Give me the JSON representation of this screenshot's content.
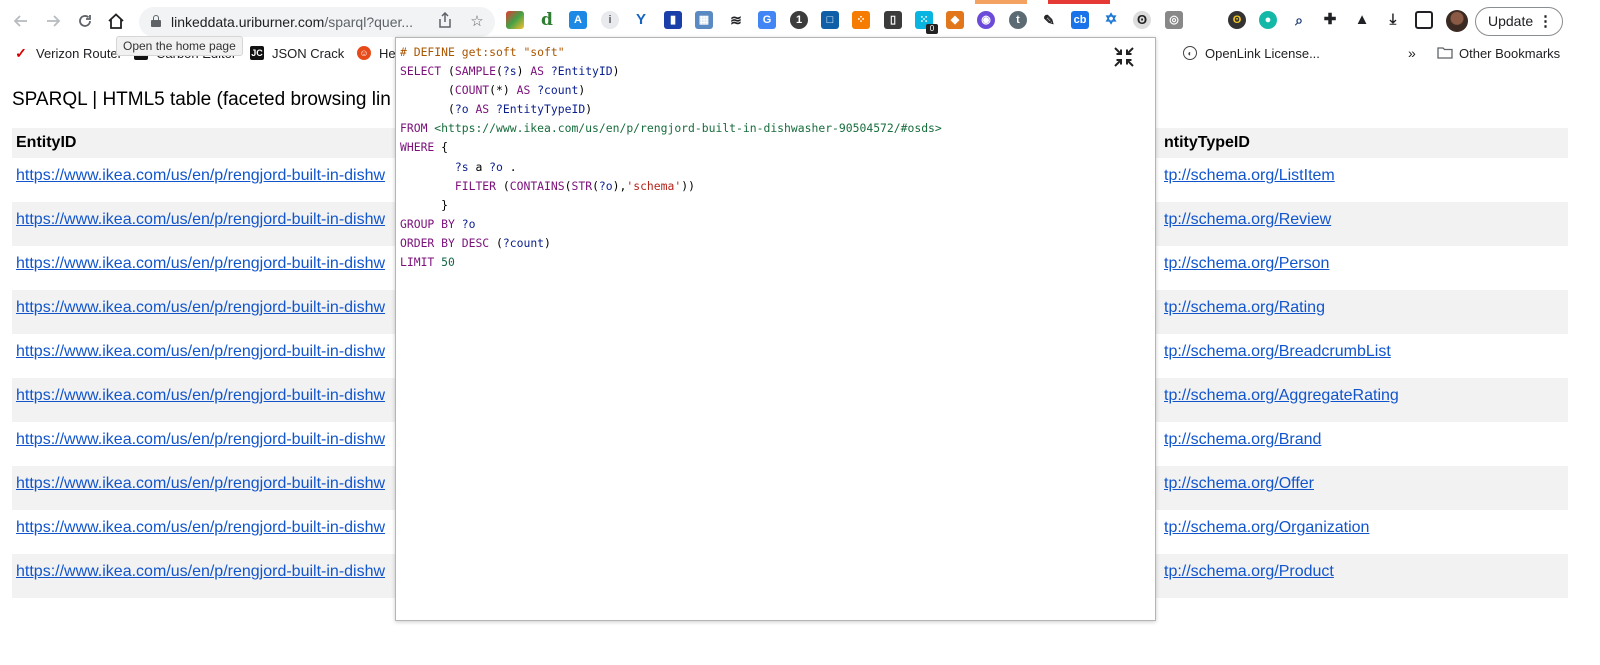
{
  "browser": {
    "url_host": "linkeddata.uriburner.com",
    "url_rest": "/sparql?quer...",
    "tooltip": "Open the home page",
    "update_label": "Update",
    "extension_badge": "0"
  },
  "bookmarks": [
    {
      "label": "Verizon Router",
      "icon": "verizon-check-icon"
    },
    {
      "label": "Carbon Editor",
      "icon": "carbon-icon"
    },
    {
      "label": "JSON Crack",
      "icon": "jc-icon"
    },
    {
      "label": "He",
      "icon": "he-icon"
    },
    {
      "label": "OpenLink License...",
      "icon": "openlink-icon"
    }
  ],
  "bookmarks_overflow": "»",
  "other_bookmarks": "Other Bookmarks",
  "page": {
    "title": "SPARQL | HTML5 table (faceted browsing lin",
    "columns": [
      "EntityID",
      "ntityTypeID"
    ],
    "rows": [
      {
        "entity": "https://www.ikea.com/us/en/p/rengjord-built-in-dishw",
        "type": "tp://schema.org/ListItem"
      },
      {
        "entity": "https://www.ikea.com/us/en/p/rengjord-built-in-dishw",
        "type": "tp://schema.org/Review"
      },
      {
        "entity": "https://www.ikea.com/us/en/p/rengjord-built-in-dishw",
        "type": "tp://schema.org/Person"
      },
      {
        "entity": "https://www.ikea.com/us/en/p/rengjord-built-in-dishw",
        "type": "tp://schema.org/Rating"
      },
      {
        "entity": "https://www.ikea.com/us/en/p/rengjord-built-in-dishw",
        "type": "tp://schema.org/BreadcrumbList"
      },
      {
        "entity": "https://www.ikea.com/us/en/p/rengjord-built-in-dishw",
        "type": "tp://schema.org/AggregateRating"
      },
      {
        "entity": "https://www.ikea.com/us/en/p/rengjord-built-in-dishw",
        "type": "tp://schema.org/Brand"
      },
      {
        "entity": "https://www.ikea.com/us/en/p/rengjord-built-in-dishw",
        "type": "tp://schema.org/Offer"
      },
      {
        "entity": "https://www.ikea.com/us/en/p/rengjord-built-in-dishw",
        "type": "tp://schema.org/Organization"
      },
      {
        "entity": "https://www.ikea.com/us/en/p/rengjord-built-in-dishw",
        "type": "tp://schema.org/Product"
      }
    ]
  },
  "query": {
    "line1": "# DEFINE get:soft \"soft\"",
    "line2_kw": "SELECT",
    "line2_a": " (",
    "line2_fn": "SAMPLE",
    "line2_b": "(",
    "line2_var": "?s",
    "line2_c": ") ",
    "line2_as": "AS",
    "line2_d": " ",
    "line2_alias": "?EntityID",
    "line2_e": ")",
    "line3_a": "       (",
    "line3_fn": "COUNT",
    "line3_b": "(*) ",
    "line3_as": "AS",
    "line3_c": " ",
    "line3_alias": "?count",
    "line3_d": ")",
    "line4_a": "       (",
    "line4_var": "?o",
    "line4_b": " ",
    "line4_as": "AS",
    "line4_c": " ",
    "line4_alias": "?EntityTypeID",
    "line4_d": ")",
    "line5_kw": "FROM",
    "line5_a": " ",
    "line5_iri": "<https://www.ikea.com/us/en/p/rengjord-built-in-dishwasher-90504572/#osds>",
    "line6_kw": "WHERE",
    "line6_a": " {",
    "line7_a": "        ",
    "line7_s": "?s",
    "line7_b": " a ",
    "line7_o": "?o",
    "line7_c": " .",
    "line8_a": "        ",
    "line8_kw": "FILTER",
    "line8_b": " (",
    "line8_fn1": "CONTAINS",
    "line8_c": "(",
    "line8_fn2": "STR",
    "line8_d": "(",
    "line8_var": "?o",
    "line8_e": "),",
    "line8_str": "'schema'",
    "line8_f": "))",
    "line9": "      }",
    "line10_kw": "GROUP BY",
    "line10_a": " ",
    "line10_var": "?o",
    "line11_kw": "ORDER BY",
    "line11_a": " ",
    "line11_fn": "DESC",
    "line11_b": " (",
    "line11_var": "?count",
    "line11_c": ")",
    "line12_kw": "LIMIT",
    "line12_a": " ",
    "line12_num": "50"
  },
  "colors": {
    "link": "#1155cc",
    "keyword": "#7a0f7a",
    "variable": "#0a1e8c",
    "string": "#b3241c",
    "iri": "#176d3c",
    "comment": "#aa5500"
  }
}
